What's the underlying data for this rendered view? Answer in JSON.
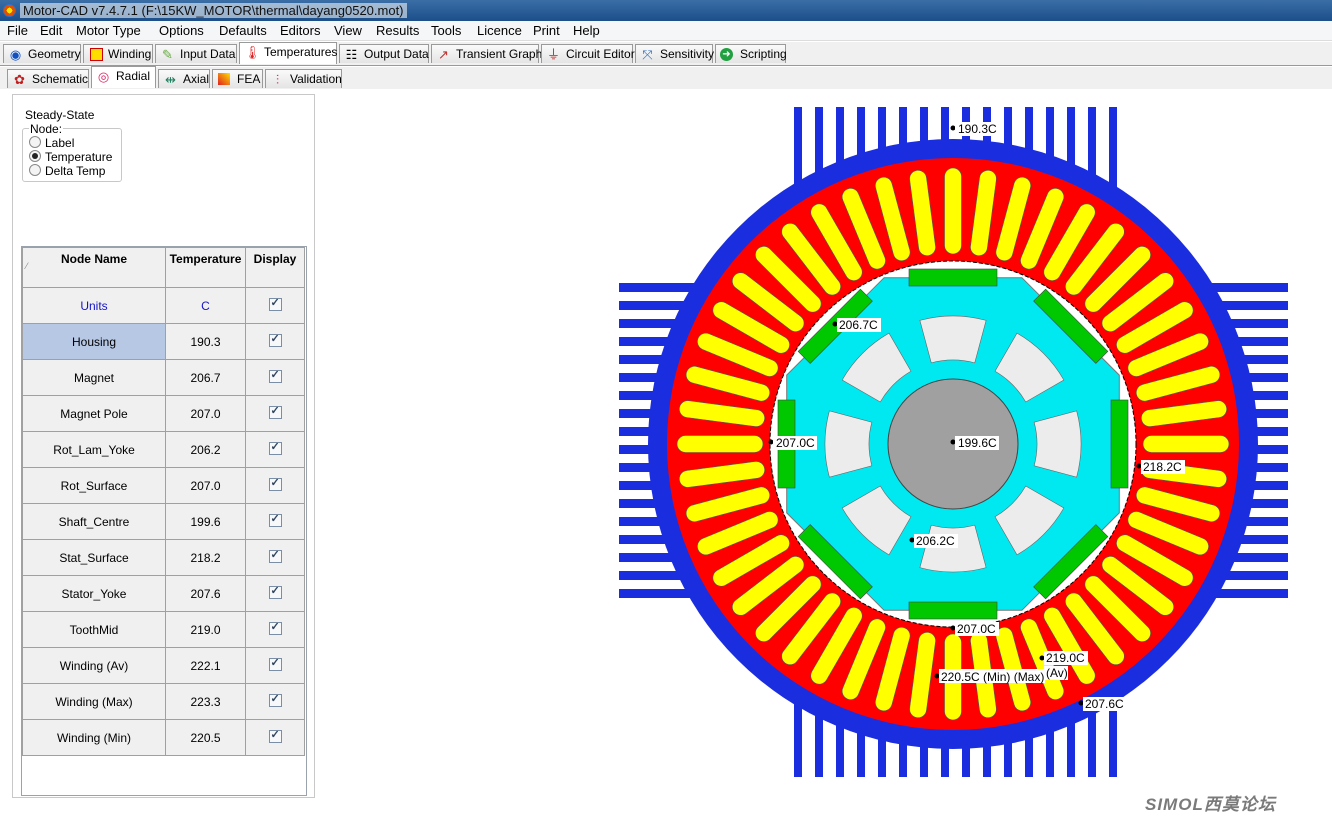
{
  "window": {
    "title": "Motor-CAD v7.4.7.1 (F:\\15KW_MOTOR\\thermal\\dayang0520.mot)"
  },
  "menu": [
    "File",
    "Edit",
    "Motor Type",
    "Options",
    "Defaults",
    "Editors",
    "View",
    "Results",
    "Tools",
    "Licence",
    "Print",
    "Help"
  ],
  "main_tabs": [
    {
      "label": "Geometry",
      "icon": "geometry-icon"
    },
    {
      "label": "Winding",
      "icon": "winding-icon"
    },
    {
      "label": "Input Data",
      "icon": "input-data-icon"
    },
    {
      "label": "Temperatures",
      "icon": "thermometer-icon"
    },
    {
      "label": "Output Data",
      "icon": "output-data-icon"
    },
    {
      "label": "Transient Graph",
      "icon": "graph-icon"
    },
    {
      "label": "Circuit Editor",
      "icon": "circuit-icon"
    },
    {
      "label": "Sensitivity",
      "icon": "sensitivity-icon"
    },
    {
      "label": "Scripting",
      "icon": "scripting-icon"
    }
  ],
  "sub_tabs": [
    {
      "label": "Schematic",
      "icon": "schematic-icon"
    },
    {
      "label": "Radial",
      "icon": "radial-icon"
    },
    {
      "label": "Axial",
      "icon": "axial-icon"
    },
    {
      "label": "FEA",
      "icon": "fea-icon"
    },
    {
      "label": "Validation",
      "icon": "validation-icon"
    }
  ],
  "panel": {
    "mode": "Steady-State",
    "node_group": "Node:",
    "options": [
      "Label",
      "Temperature",
      "Delta Temp"
    ],
    "selected_option": "Temperature"
  },
  "table": {
    "headers": [
      "Node Name",
      "Temperature",
      "Display"
    ],
    "units": {
      "name": "Units",
      "value": "C"
    },
    "rows": [
      {
        "name": "Housing",
        "value": "190.3"
      },
      {
        "name": "Magnet",
        "value": "206.7"
      },
      {
        "name": "Magnet Pole",
        "value": "207.0"
      },
      {
        "name": "Rot_Lam_Yoke",
        "value": "206.2"
      },
      {
        "name": "Rot_Surface",
        "value": "207.0"
      },
      {
        "name": "Shaft_Centre",
        "value": "199.6"
      },
      {
        "name": "Stat_Surface",
        "value": "218.2"
      },
      {
        "name": "Stator_Yoke",
        "value": "207.6"
      },
      {
        "name": "ToothMid",
        "value": "219.0"
      },
      {
        "name": "Winding (Av)",
        "value": "222.1"
      },
      {
        "name": "Winding (Max)",
        "value": "223.3"
      },
      {
        "name": "Winding (Min)",
        "value": "220.5"
      }
    ],
    "selected_row": "Housing"
  },
  "diagram": {
    "labels": {
      "housing": "190.3C",
      "magnet": "206.7C",
      "rot_surface": "207.0C",
      "shaft": "199.6C",
      "stat_surface": "218.2C",
      "rot_lam_yoke": "206.2C",
      "magnet_pole": "207.0C",
      "toothmid": "219.0C",
      "winding_av": "(Av)",
      "winding_min_max": "220.5C (Min) (Max)",
      "stator_yoke": "207.6C"
    },
    "colors": {
      "housing": "#1a2ee0",
      "stator": "#ff0000",
      "winding": "#ffff00",
      "rotor": "#00e8f0",
      "magnet": "#00c800",
      "shaft": "#a0a0a0",
      "pocket": "#ececec"
    }
  },
  "watermark": "SIMOL西莫论坛"
}
